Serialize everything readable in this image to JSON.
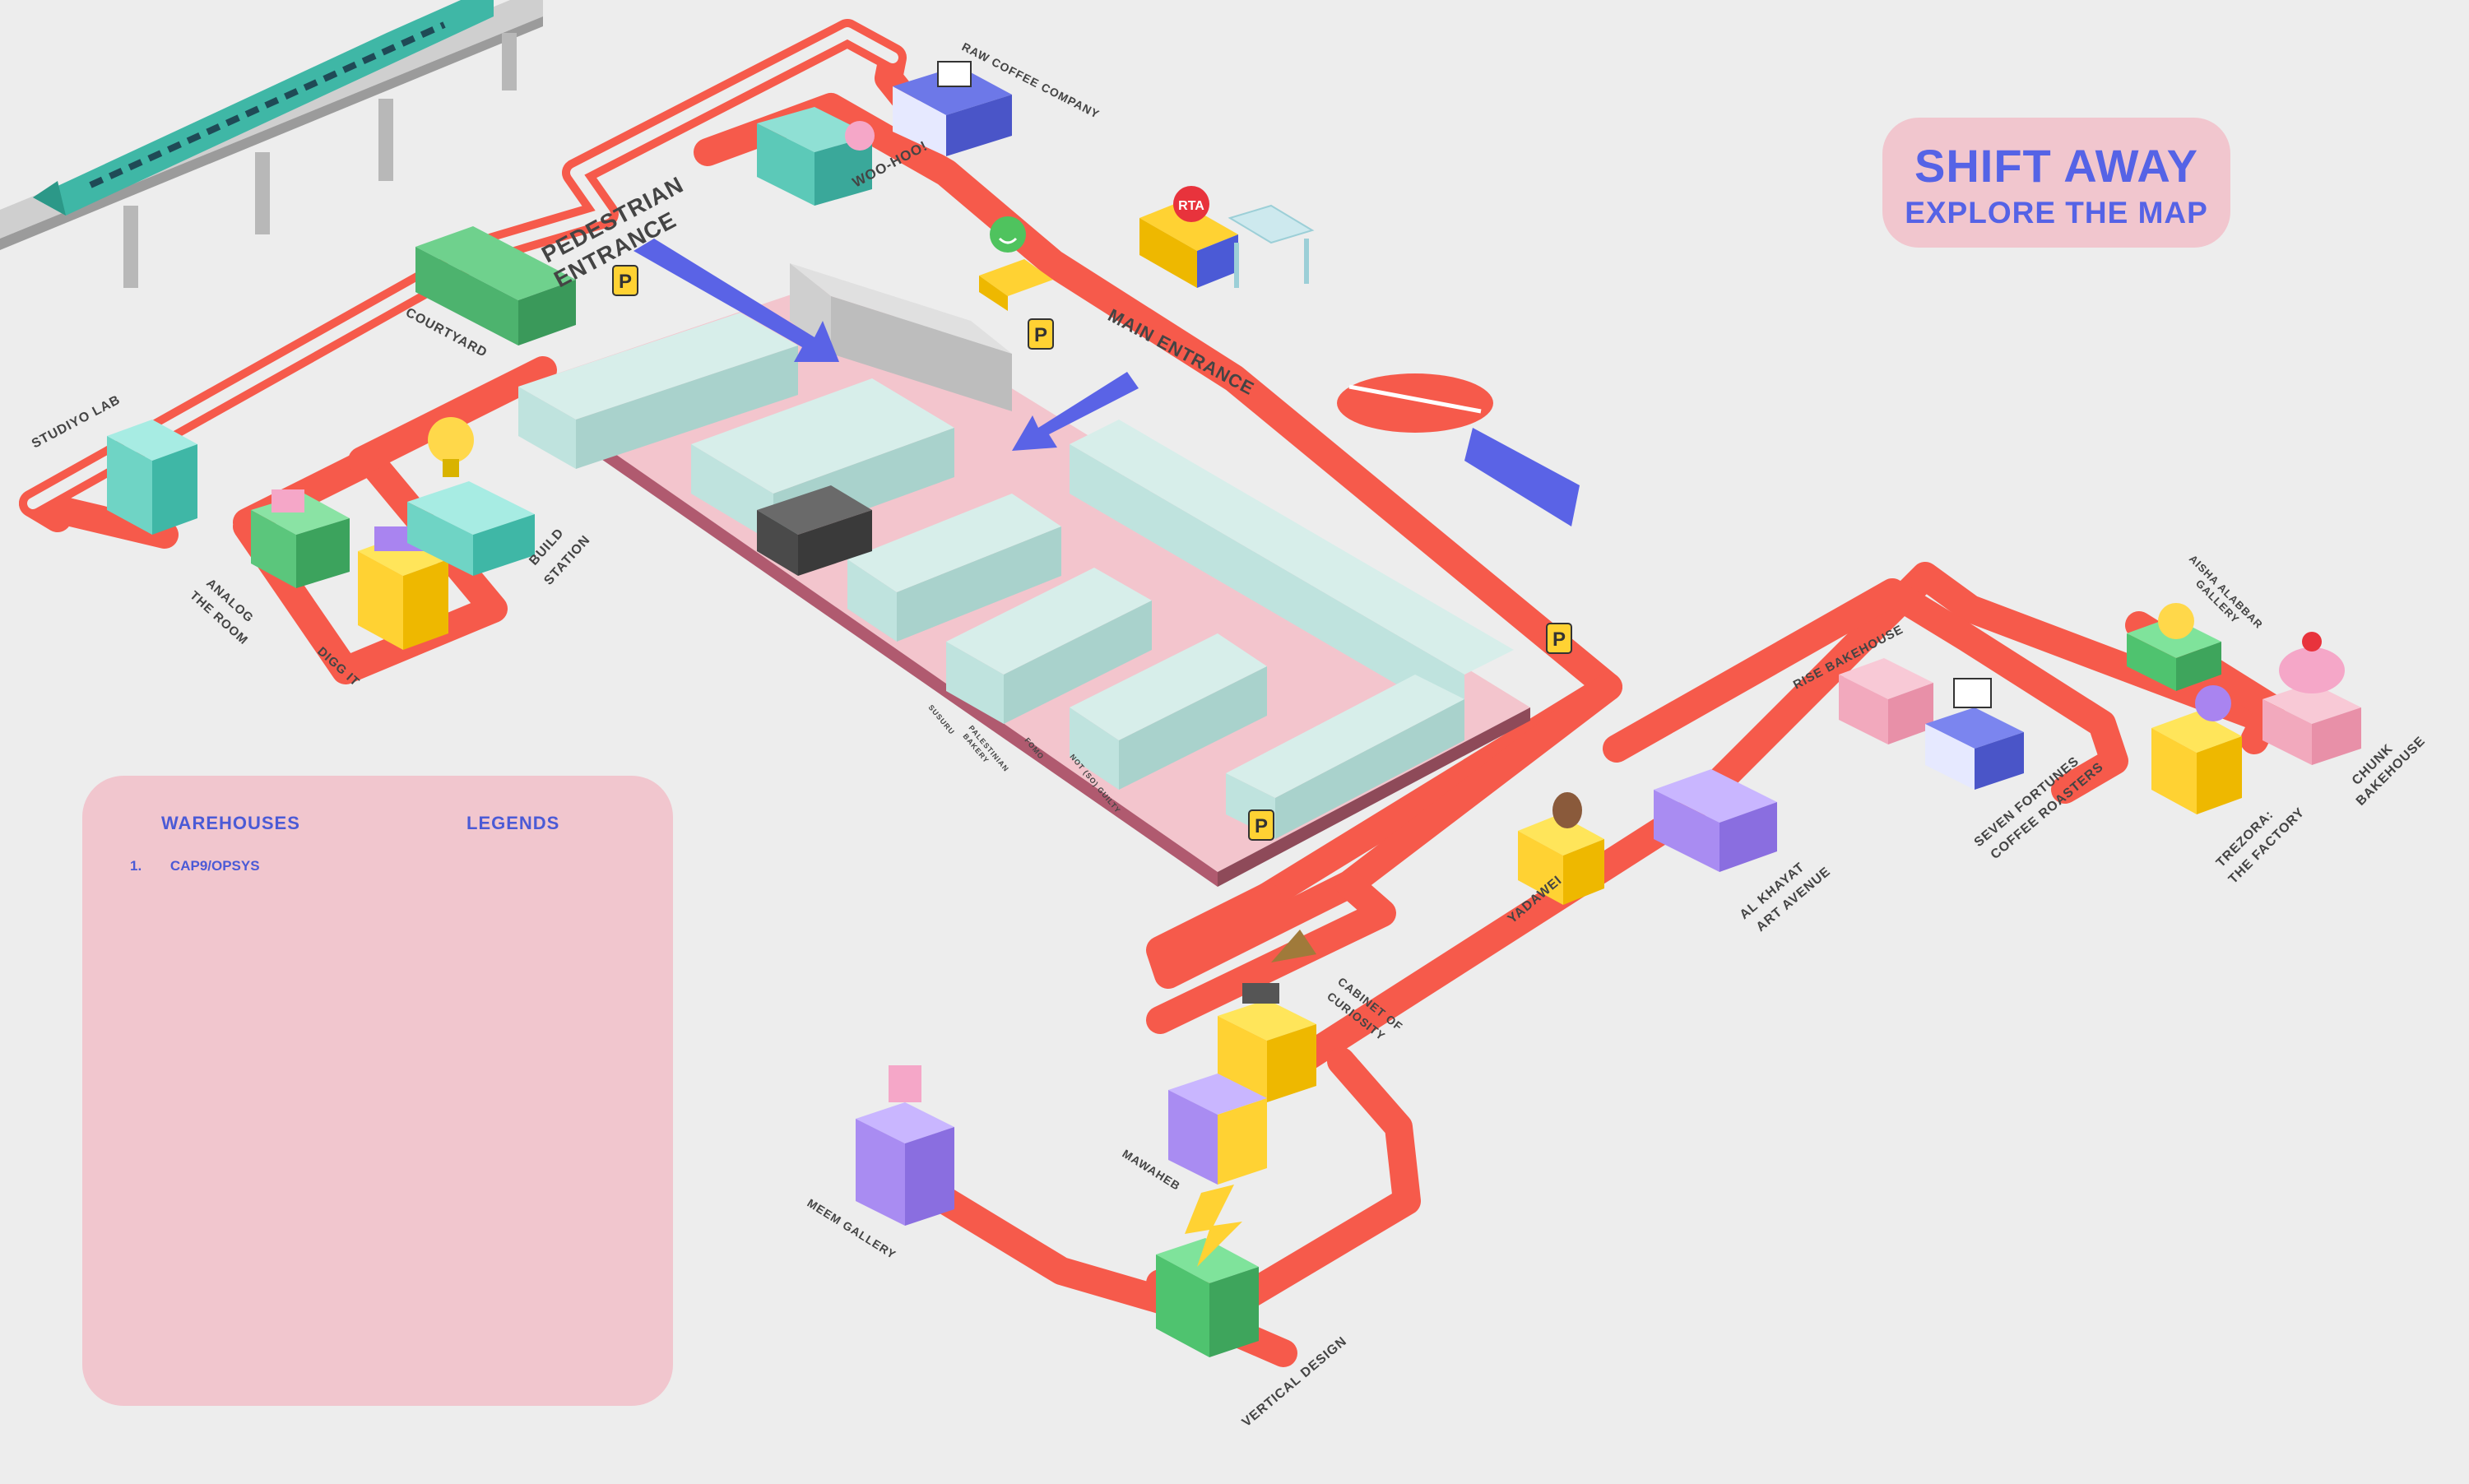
{
  "badge": {
    "title": "SHIFT AWAY",
    "subtitle": "EXPLORE THE MAP"
  },
  "panel": {
    "warehouses_heading": "WAREHOUSES",
    "legends_heading": "LEGENDS",
    "warehouses": [
      {
        "number": "1.",
        "name": "CAP9/OPSYS"
      }
    ]
  },
  "entrances": {
    "pedestrian": [
      "PEDESTRIAN",
      "ENTRANCE"
    ],
    "main": "MAIN ENTRANCE"
  },
  "venues": {
    "raw_coffee": "RAW COFFEE COMPANY",
    "woo_hoo": "WOO-HOO!",
    "courtyard": "COURTYARD",
    "studiyo_lab": "STUDIYO LAB",
    "analog_the_room": [
      "ANALOG",
      "THE ROOM"
    ],
    "digg_it": "DIGG IT",
    "build_station": [
      "BUILD",
      "STATION"
    ],
    "rise_bakehouse": "RISE BAKEHOUSE",
    "aisha_alabbar": [
      "AISHA ALABBAR",
      "GALLERY"
    ],
    "seven_fortunes": [
      "SEVEN FORTUNES",
      "COFFEE ROASTERS"
    ],
    "trezora": [
      "TREZORA:",
      "THE FACTORY"
    ],
    "chunk_bakehouse": [
      "CHUNK",
      "BAKEHOUSE"
    ],
    "yadawei": "YADAWEI",
    "al_khayat": [
      "AL KHAYAT",
      "ART AVENUE"
    ],
    "cabinet_of_curiosity": [
      "CABINET OF",
      "CURIOSITY"
    ],
    "mawaheb": "MAWAHEB",
    "meem_gallery": "MEEM GALLERY",
    "vertical_design": "VERTICAL DESIGN"
  },
  "shops": {
    "susuru": "SUSURU",
    "palestinian_bakery": [
      "PALESTINIAN",
      "BAKERY"
    ],
    "fomo": "FOMO",
    "not_so_guilty": "NOT (SO) GUILTY"
  },
  "signs": {
    "parking": "P",
    "rta": "RTA"
  },
  "colors": {
    "route": "#f65a4b",
    "plaza": "#f3c5cd",
    "building": "#bfe3de",
    "badge_text": "#5563e6",
    "panel": "#f1c6ce"
  }
}
